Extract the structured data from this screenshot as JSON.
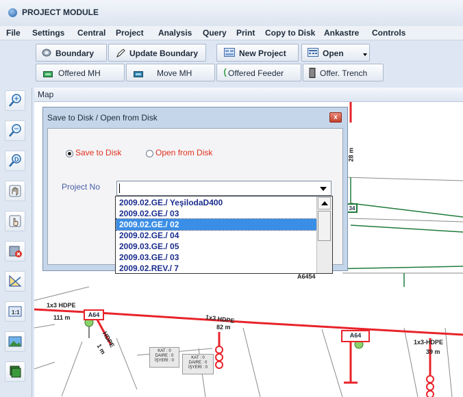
{
  "app": {
    "title": "PROJECT MODULE"
  },
  "menu": [
    "File",
    "Settings",
    "Central",
    "Project",
    "Analysis",
    "Query",
    "Print",
    "Copy to Disk",
    "Ankastre",
    "Controls"
  ],
  "toolbar_row1": {
    "boundary": "Boundary",
    "update_boundary": "Update Boundary",
    "new_project": "New Project",
    "open": "Open"
  },
  "toolbar_row2": {
    "offered_mh": "Offered MH",
    "move_mh": "Move MH",
    "offered_feeder": "Offered Feeder",
    "offer_trench": "Offer. Trench"
  },
  "map_panel": {
    "title": "Map"
  },
  "left_tools": [
    "zoom-in-icon",
    "zoom-out-icon",
    "zoom-extent-icon",
    "pan-hand-icon",
    "select-hand-icon",
    "delete-icon",
    "measure-icon",
    "scale-icon",
    "image-icon",
    "layers-icon"
  ],
  "dialog": {
    "title": "Save to Disk / Open from Disk",
    "close_symbol": "x",
    "mode_options": [
      "Save to Disk",
      "Open from Disk"
    ],
    "selected_mode": "Save to Disk",
    "project_no_label": "Project No",
    "project_no_value": "",
    "list_items": [
      "2009.02.GE./ YeşilodaD400",
      "2009.02.GE./ 03",
      "2009.02.GE./ 02",
      "2009.02.GE./ 04",
      "2009.03.GE./ 05",
      "2009.03.GE./ 03",
      "2009.02.REV./ 7"
    ],
    "selected_item": "2009.02.GE./ 02"
  },
  "map_labels": {
    "hdpe1": "1x3 HDPE",
    "m111": "111 m",
    "hdpe2": "1x3 HDPE",
    "m82": "82 m",
    "hdpe3": "1x3-HDPE",
    "m39": "39 m",
    "hdpe_diag": "HDPE",
    "m1": "1 m",
    "m28": "28 m",
    "a6454": "A6454",
    "box1": "A64",
    "box2": "A64",
    "box3": "34",
    "bldg1": [
      "KAT : 0",
      "DAIRE : 0",
      "İŞYERİ : 0"
    ],
    "bldg2": [
      "KAT : 0",
      "DAIRE : 0",
      "İŞYERİ : 0"
    ]
  },
  "colors": {
    "accent_red": "#e8232a",
    "route_green": "#1e7a3a",
    "selection_blue": "#3a8ee6",
    "list_text": "#1a2c8c"
  }
}
